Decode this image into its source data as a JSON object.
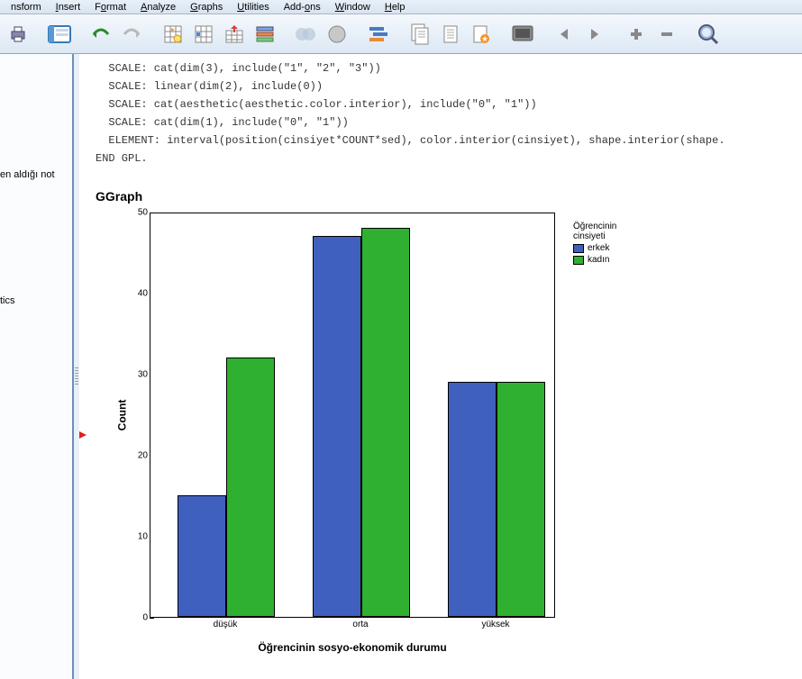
{
  "menus": {
    "transform": "nsform",
    "insert": "Insert",
    "format": "Format",
    "analyze": "Analyze",
    "graphs": "Graphs",
    "utilities": "Utilities",
    "addons": "Add-ons",
    "window": "Window",
    "help": "Help"
  },
  "left_pane": {
    "line1": "en aldığı not",
    "line2": "tics"
  },
  "code_lines": {
    "l1": "  SCALE: cat(dim(3), include(\"1\", \"2\", \"3\"))",
    "l2": "  SCALE: linear(dim(2), include(0))",
    "l3": "  SCALE: cat(aesthetic(aesthetic.color.interior), include(\"0\", \"1\"))",
    "l4": "  SCALE: cat(dim(1), include(\"0\", \"1\"))",
    "l5": "  ELEMENT: interval(position(cinsiyet*COUNT*sed), color.interior(cinsiyet), shape.interior(shape.",
    "l6": "END GPL."
  },
  "graph_heading": "GGraph",
  "chart_data": {
    "type": "bar",
    "categories": [
      "düşük",
      "orta",
      "yüksek"
    ],
    "series": [
      {
        "name": "erkek",
        "values": [
          15,
          47,
          29
        ],
        "color": "#4060c0"
      },
      {
        "name": "kadın",
        "values": [
          32,
          48,
          29
        ],
        "color": "#30b030"
      }
    ],
    "title": "",
    "xlabel": "Öğrencinin sosyo-ekonomik durumu",
    "ylabel": "Count",
    "ylim": [
      0,
      50
    ],
    "y_ticks": [
      0,
      10,
      20,
      30,
      40,
      50
    ],
    "legend_title": "Öğrencinin\ncinsiyeti"
  }
}
